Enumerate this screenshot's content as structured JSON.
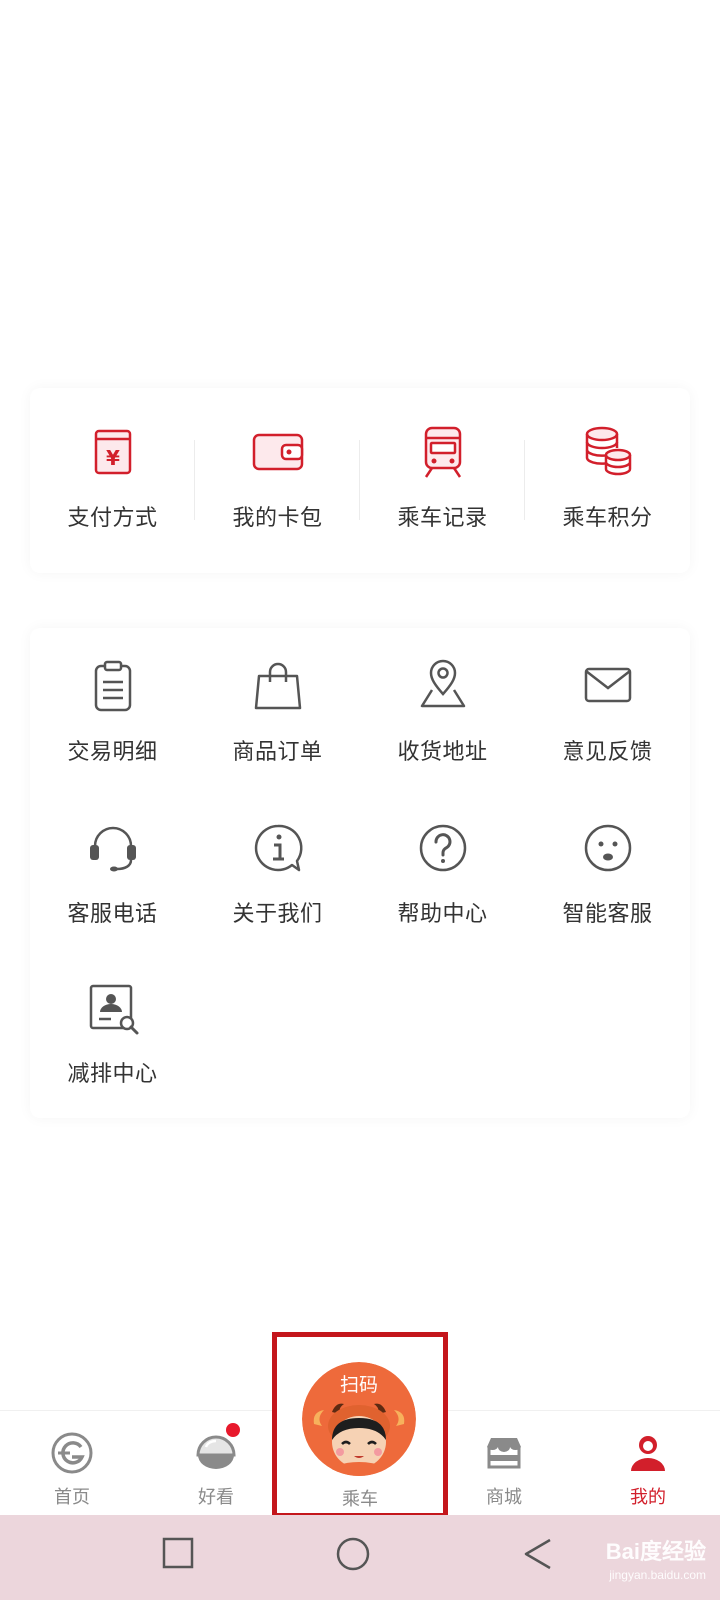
{
  "quick_actions": [
    {
      "label": "支付方式",
      "icon": "payment-yen-icon"
    },
    {
      "label": "我的卡包",
      "icon": "wallet-icon"
    },
    {
      "label": "乘车记录",
      "icon": "train-icon"
    },
    {
      "label": "乘车积分",
      "icon": "coins-icon"
    }
  ],
  "menu": [
    {
      "label": "交易明细",
      "icon": "clipboard-icon"
    },
    {
      "label": "商品订单",
      "icon": "shopping-bag-icon"
    },
    {
      "label": "收货地址",
      "icon": "map-pin-icon"
    },
    {
      "label": "意见反馈",
      "icon": "envelope-icon"
    },
    {
      "label": "客服电话",
      "icon": "headset-icon"
    },
    {
      "label": "关于我们",
      "icon": "info-bubble-icon"
    },
    {
      "label": "帮助中心",
      "icon": "question-icon"
    },
    {
      "label": "智能客服",
      "icon": "chat-face-icon"
    },
    {
      "label": "减排中心",
      "icon": "profile-search-icon"
    }
  ],
  "tabbar": {
    "home": "首页",
    "discover": "好看",
    "ride": "乘车",
    "scan_badge": "扫码",
    "mall": "商城",
    "mine": "我的"
  },
  "watermark": {
    "brand": "Bai度经验",
    "url": "jingyan.baidu.com"
  },
  "colors": {
    "accent_red": "#d21f2b",
    "icon_gray": "#555555",
    "scan_orange": "#ee6a3b",
    "system_bar": "#ecd6dc"
  }
}
